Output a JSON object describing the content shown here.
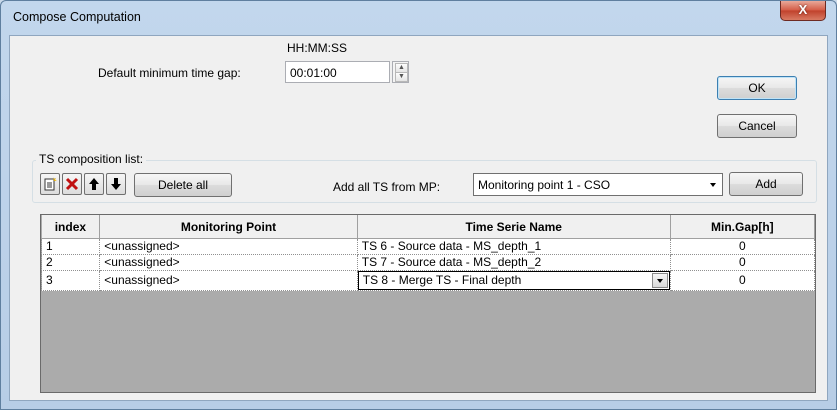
{
  "window": {
    "title": "Compose Computation",
    "close_glyph": "X"
  },
  "time_gap": {
    "format_label": "HH:MM:SS",
    "label": "Default minimum time gap:",
    "value": "00:01:00"
  },
  "buttons": {
    "ok": "OK",
    "cancel": "Cancel",
    "delete_all": "Delete all",
    "add": "Add"
  },
  "composition": {
    "group_label": "TS composition list:",
    "add_from_label": "Add all TS from MP:",
    "mp_selected": "Monitoring point 1 - CSO",
    "toolbar_icons": [
      "new-icon",
      "delete-icon",
      "arrow-up-icon",
      "arrow-down-icon"
    ]
  },
  "table": {
    "columns": [
      "index",
      "Monitoring Point",
      "Time Serie Name",
      "Min.Gap[h]"
    ],
    "rows": [
      {
        "index": "1",
        "mp": "<unassigned>",
        "ts": "TS 6 - Source data - MS_depth_1",
        "gap": "0"
      },
      {
        "index": "2",
        "mp": "<unassigned>",
        "ts": "TS 7 - Source data - MS_depth_2",
        "gap": "0"
      },
      {
        "index": "3",
        "mp": "<unassigned>",
        "ts": "TS 8 - Merge TS -  Final depth",
        "gap": "0"
      }
    ]
  },
  "colors": {
    "titlebar": "#c2d7ed",
    "close": "#c0412b",
    "grid_bg": "#ababab"
  }
}
